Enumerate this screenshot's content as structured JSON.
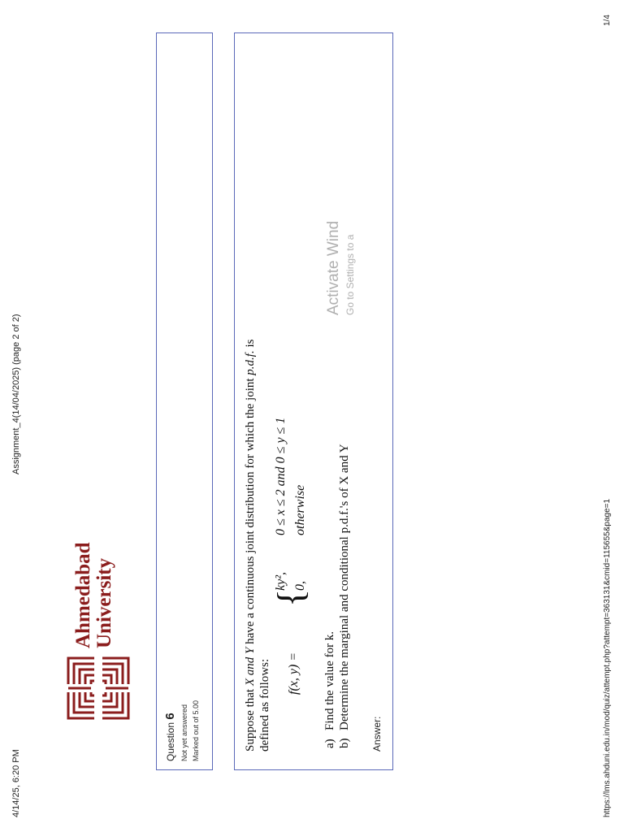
{
  "print_header": {
    "datetime": "4/14/25, 6:20 PM",
    "title": "Assignment_4(14/04/2025) (page 2 of 2)"
  },
  "print_footer": {
    "url": "https://lms.ahduni.edu.in/mod/quiz/attempt.php?attempt=363131&cmid=115655&page=1",
    "page": "1/4"
  },
  "logo": {
    "line1": "Ahmedabad",
    "line2": "University",
    "color": "#8b1d1d"
  },
  "question": {
    "label": "Question",
    "number": "6",
    "status": "Not yet answered",
    "marks": "Marked out of 5.00",
    "box_border_color": "#5a68b8",
    "intro_line1_a": "Suppose that ",
    "intro_line1_b": "X and Y",
    "intro_line1_c": " have a continuous joint distribution for which the joint ",
    "intro_line1_d": "p.d.f.",
    "intro_line1_e": " is",
    "intro_line2": "defined as follows:",
    "formula_lhs": "f(x, y) =",
    "case1_value": "ky²,",
    "case1_condition": "0 ≤ x ≤ 2 and 0 ≤ y ≤ 1",
    "case2_value": "0,",
    "case2_condition": "otherwise",
    "part_a_label": "a)",
    "part_a_text": "Find the value for k.",
    "part_b_label": "b)",
    "part_b_text": "Determine the marginal and conditional p.d.f.'s of X and Y",
    "answer_label": "Answer:"
  },
  "watermark": {
    "line1": "Activate Wind",
    "line2": "Go to Settings to a"
  },
  "icons": {
    "collapse": "chevron-down-icon"
  }
}
